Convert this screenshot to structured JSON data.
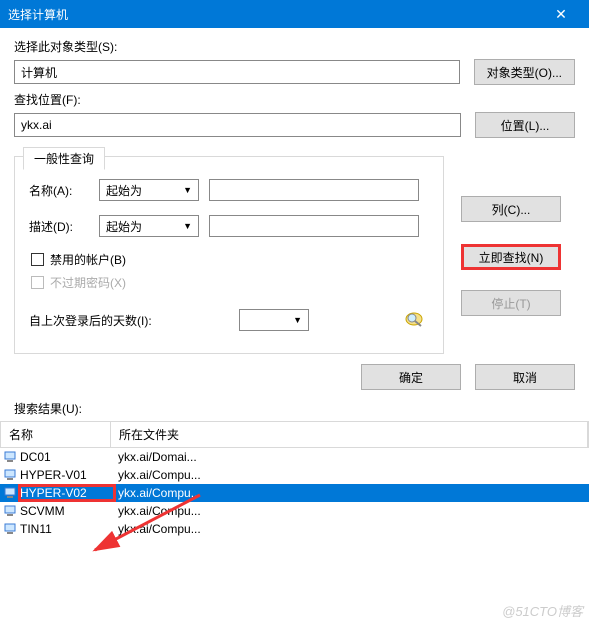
{
  "titlebar": {
    "title": "选择计算机",
    "close": "✕"
  },
  "objectType": {
    "label": "选择此对象类型(S):",
    "value": "计算机",
    "button": "对象类型(O)..."
  },
  "location": {
    "label": "查找位置(F):",
    "value": "ykx.ai",
    "button": "位置(L)..."
  },
  "tab": {
    "title": "一般性查询",
    "name": {
      "label": "名称(A):",
      "select": "起始为"
    },
    "desc": {
      "label": "描述(D):",
      "select": "起始为"
    },
    "disabledAcct": "禁用的帐户(B)",
    "noExpire": "不过期密码(X)",
    "daysSince": "自上次登录后的天数(I):"
  },
  "sideButtons": {
    "columns": "列(C)...",
    "findNow": "立即查找(N)",
    "stop": "停止(T)"
  },
  "bottom": {
    "ok": "确定",
    "cancel": "取消"
  },
  "results": {
    "label": "搜索结果(U):",
    "headers": {
      "name": "名称",
      "folder": "所在文件夹"
    },
    "rows": [
      {
        "name": "DC01",
        "folder": "ykx.ai/Domai...",
        "selected": false
      },
      {
        "name": "HYPER-V01",
        "folder": "ykx.ai/Compu...",
        "selected": false
      },
      {
        "name": "HYPER-V02",
        "folder": "ykx.ai/Compu...",
        "selected": true
      },
      {
        "name": "SCVMM",
        "folder": "ykx.ai/Compu...",
        "selected": false
      },
      {
        "name": "TIN11",
        "folder": "ykx.ai/Compu...",
        "selected": false
      }
    ]
  },
  "watermark": "@51CTO博客"
}
